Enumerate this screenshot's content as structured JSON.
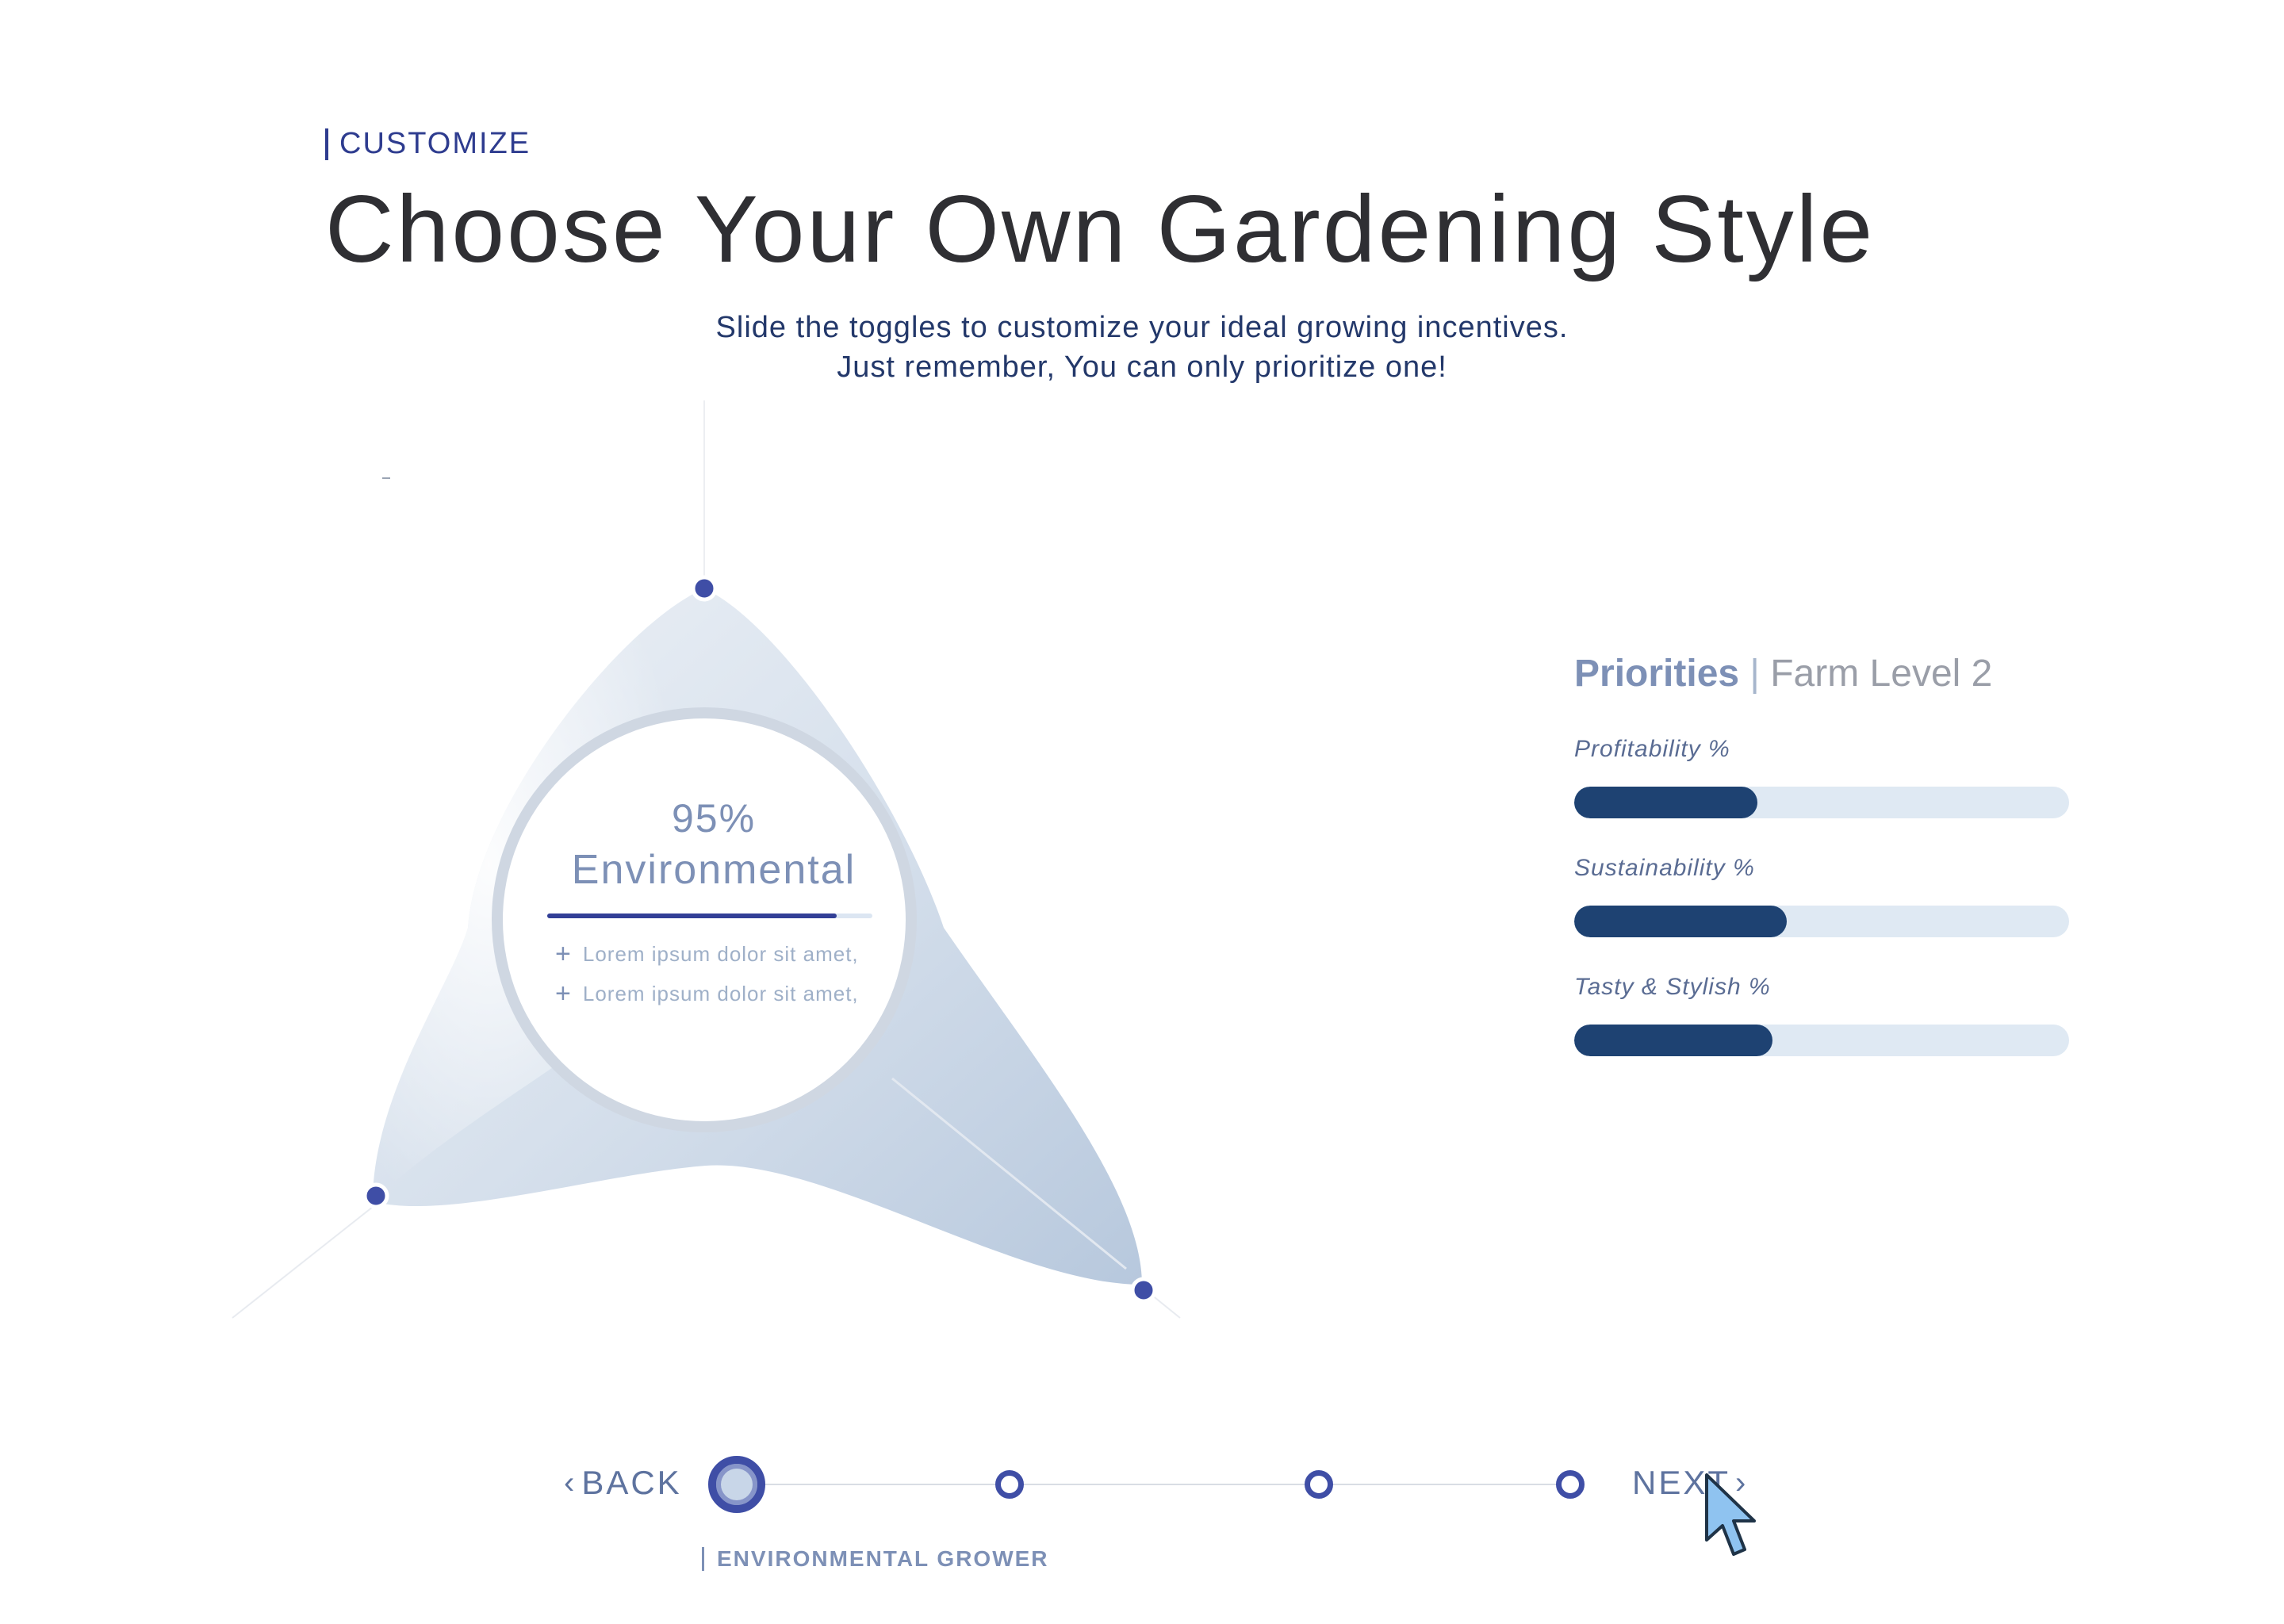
{
  "header": {
    "eyebrow": "CUSTOMIZE",
    "title": "Choose Your Own Gardening Style",
    "subtitle_line1": "Slide the toggles to customize your ideal growing incentives.",
    "subtitle_line2": "Just remember, You can only prioritize one!"
  },
  "triangle": {
    "percent": "95%",
    "category": "Environmental",
    "focus_level": 0.89,
    "bullets": [
      "Lorem ipsum dolor sit amet,",
      "Lorem ipsum dolor sit amet,"
    ]
  },
  "priorities": {
    "title_bold": "Priorities",
    "separator": "|",
    "title_light": "Farm Level 2",
    "metrics": [
      {
        "label": "Profitability %",
        "value": 0.37
      },
      {
        "label": "Sustainability %",
        "value": 0.43
      },
      {
        "label": "Tasty & Stylish %",
        "value": 0.4
      }
    ]
  },
  "stepper": {
    "back_label": "BACK",
    "next_label": "NEXT",
    "current_step_label": "ENVIRONMENTAL GROWER",
    "current_step": 1,
    "total_steps": 4
  },
  "colors": {
    "accent": "#3f4ea6",
    "bar_fill": "#1e4272",
    "bar_track": "#dfe9f3",
    "muted_text": "#7d90b6",
    "title_text": "#2f2f33"
  },
  "icons": [
    "chevron-left-icon",
    "chevron-right-icon",
    "plus-icon",
    "mouse-pointer-icon"
  ]
}
